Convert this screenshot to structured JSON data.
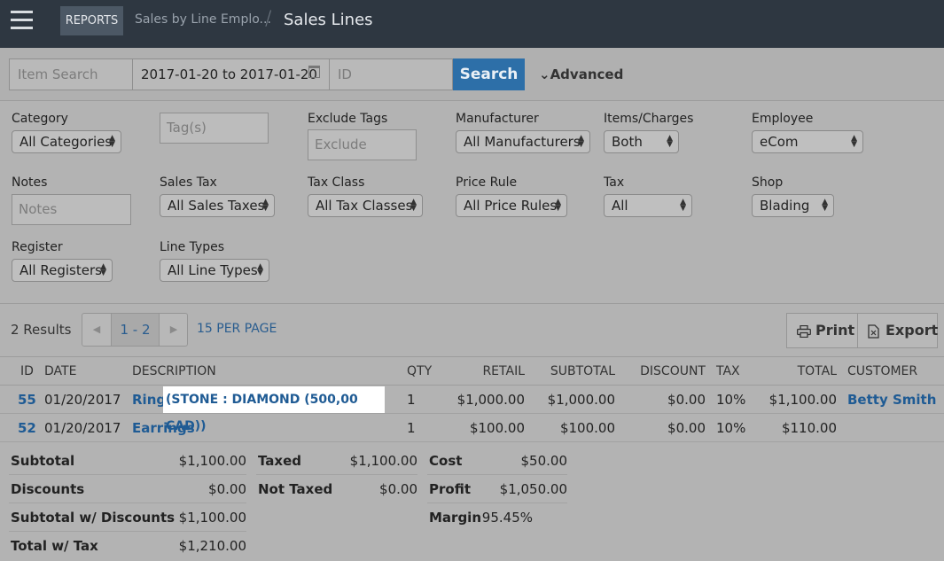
{
  "header": {
    "menu_icon": "hamburger-icon",
    "crumb_reports": "REPORTS",
    "crumb_parent": "Sales by Line Emplo...",
    "separator": "/",
    "title": "Sales Lines"
  },
  "search": {
    "item_placeholder": "Item Search",
    "date_value": "2017-01-20 to 2017-01-20",
    "calendar_icon": "calendar-icon",
    "id_placeholder": "ID",
    "search_label": "Search",
    "advanced_label": "Advanced"
  },
  "filters": {
    "category": {
      "label": "Category",
      "value": "All Categories"
    },
    "tags": {
      "placeholder": "Tag(s)"
    },
    "exclude_tags": {
      "label": "Exclude Tags",
      "placeholder": "Exclude"
    },
    "manufacturer": {
      "label": "Manufacturer",
      "value": "All Manufacturers"
    },
    "items_charges": {
      "label": "Items/Charges",
      "value": "Both"
    },
    "employee": {
      "label": "Employee",
      "value": "eCom"
    },
    "notes": {
      "label": "Notes",
      "placeholder": "Notes"
    },
    "sales_tax": {
      "label": "Sales Tax",
      "value": "All Sales Taxes"
    },
    "tax_class": {
      "label": "Tax Class",
      "value": "All Tax Classes"
    },
    "price_rule": {
      "label": "Price Rule",
      "value": "All Price Rules"
    },
    "tax": {
      "label": "Tax",
      "value": "All"
    },
    "shop": {
      "label": "Shop",
      "value": "Blading"
    },
    "register": {
      "label": "Register",
      "value": "All Registers"
    },
    "line_types": {
      "label": "Line Types",
      "value": "All Line Types"
    }
  },
  "results": {
    "count": "2 Results",
    "page": "1 - 2",
    "per_page": "15 PER PAGE",
    "print_label": "Print",
    "export_label": "Export"
  },
  "table": {
    "headers": {
      "id": "ID",
      "date": "DATE",
      "description": "DESCRIPTION",
      "qty": "QTY",
      "retail": "RETAIL",
      "subtotal": "SUBTOTAL",
      "discount": "DISCOUNT",
      "tax": "TAX",
      "total": "TOTAL",
      "customer": "CUSTOMER"
    },
    "rows": [
      {
        "id": "55",
        "date": "01/20/2017",
        "description": "Ring",
        "detail": "(STONE : DIAMOND (500,00 CAD))",
        "qty": "1",
        "retail": "$1,000.00",
        "subtotal": "$1,000.00",
        "discount": "$0.00",
        "tax": "10%",
        "total": "$1,100.00",
        "customer": "Betty Smith"
      },
      {
        "id": "52",
        "date": "01/20/2017",
        "description": "Earrings",
        "detail": "",
        "qty": "1",
        "retail": "$100.00",
        "subtotal": "$100.00",
        "discount": "$0.00",
        "tax": "10%",
        "total": "$110.00",
        "customer": ""
      }
    ]
  },
  "summary": {
    "subtotal": {
      "label": "Subtotal",
      "value": "$1,100.00"
    },
    "discounts": {
      "label": "Discounts",
      "value": "$0.00"
    },
    "subtotal_discounts": {
      "label": "Subtotal w/ Discounts",
      "value": "$1,100.00"
    },
    "total_tax": {
      "label": "Total w/ Tax",
      "value": "$1,210.00"
    },
    "taxed": {
      "label": "Taxed",
      "value": "$1,100.00"
    },
    "not_taxed": {
      "label": "Not Taxed",
      "value": "$0.00"
    },
    "cost": {
      "label": "Cost",
      "value": "$50.00"
    },
    "profit": {
      "label": "Profit",
      "value": "$1,050.00"
    },
    "margin": {
      "label": "Margin",
      "value": "95.45%"
    }
  }
}
